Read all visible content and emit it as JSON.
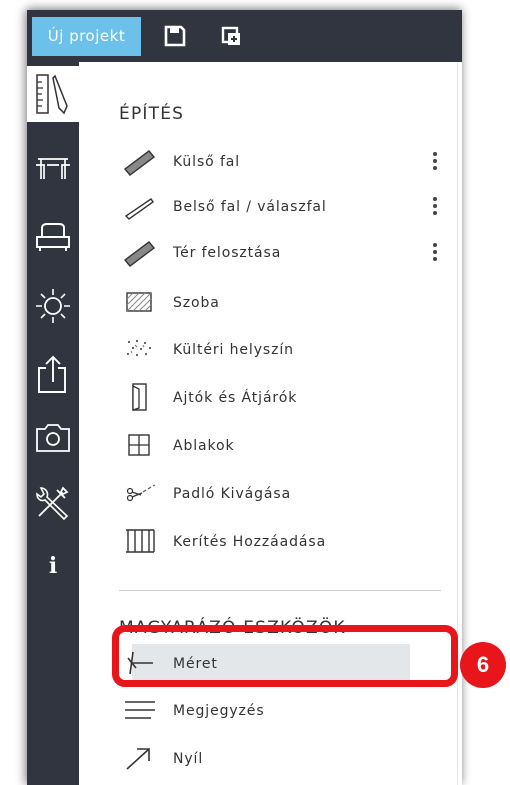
{
  "topbar": {
    "project_tab_label": "Új projekt"
  },
  "sections": {
    "building": {
      "title": "ÉPÍTÉS",
      "items": [
        {
          "label": "Külső fal",
          "icon": "exterior-wall-icon",
          "has_menu": true
        },
        {
          "label": "Belső fal / válaszfal",
          "icon": "interior-wall-icon",
          "has_menu": true
        },
        {
          "label": "Tér felosztása",
          "icon": "space-divider-icon",
          "has_menu": true
        },
        {
          "label": "Szoba",
          "icon": "room-icon"
        },
        {
          "label": "Kültéri helyszín",
          "icon": "outdoor-area-icon"
        },
        {
          "label": "Ajtók és Átjárók",
          "icon": "door-icon"
        },
        {
          "label": "Ablakok",
          "icon": "window-icon"
        },
        {
          "label": "Padló Kivágása",
          "icon": "floor-cutout-icon"
        },
        {
          "label": "Kerítés Hozzáadása",
          "icon": "fence-icon"
        }
      ]
    },
    "annotation": {
      "title": "MAGYARÁZÓ ESZKÖZÖK",
      "items": [
        {
          "label": "Méret",
          "icon": "dimension-icon",
          "selected": true
        },
        {
          "label": "Megjegyzés",
          "icon": "note-icon"
        },
        {
          "label": "Nyíl",
          "icon": "arrow-icon"
        }
      ]
    }
  },
  "callout": {
    "number": "6",
    "color": "#e8151b"
  },
  "colors": {
    "sidebar": "#303540",
    "accent": "#6cc1ea",
    "highlight": "#e8151b"
  },
  "rail_icons": [
    "build-icon",
    "furniture-icon",
    "sofa-icon",
    "light-icon",
    "export-icon",
    "camera-icon",
    "tools-icon",
    "info-icon"
  ],
  "rail_info_glyph": "i"
}
